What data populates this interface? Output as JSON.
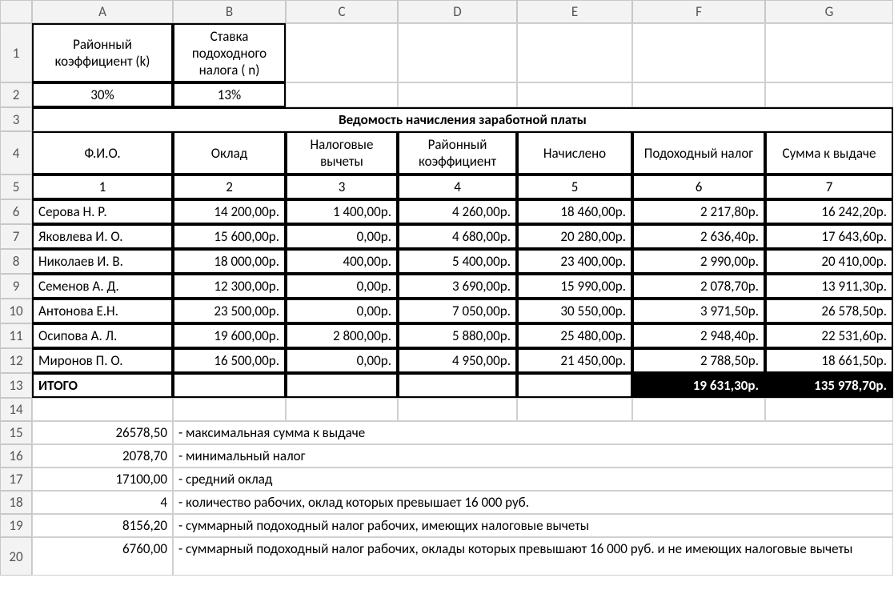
{
  "colLetters": [
    "A",
    "B",
    "C",
    "D",
    "E",
    "F",
    "G"
  ],
  "rowNums": [
    "1",
    "2",
    "3",
    "4",
    "5",
    "6",
    "7",
    "8",
    "9",
    "10",
    "11",
    "12",
    "13",
    "14",
    "15",
    "16",
    "17",
    "18",
    "19",
    "20"
  ],
  "hdr": {
    "A": "Районный коэффициент (k)",
    "B": "Ставка подоходного налога ( n)"
  },
  "vals": {
    "A": "30%",
    "B": "13%"
  },
  "title": "Ведомость начисления заработной платы",
  "th": {
    "A": "Ф.И.О.",
    "B": "Оклад",
    "C": "Налоговые вычеты",
    "D": "Районный коэффициент",
    "E": "Начислено",
    "F": "Подоходный налог",
    "G": "Сумма к выдаче"
  },
  "colnums": {
    "A": "1",
    "B": "2",
    "C": "3",
    "D": "4",
    "E": "5",
    "F": "6",
    "G": "7"
  },
  "rows": [
    {
      "A": "Серова Н. Р.",
      "B": "14 200,00р.",
      "C": "1 400,00р.",
      "D": "4 260,00р.",
      "E": "18 460,00р.",
      "F": "2 217,80р.",
      "G": "16 242,20р."
    },
    {
      "A": "Яковлева И. О.",
      "B": "15 600,00р.",
      "C": "0,00р.",
      "D": "4 680,00р.",
      "E": "20 280,00р.",
      "F": "2 636,40р.",
      "G": "17 643,60р."
    },
    {
      "A": "Николаев И. В.",
      "B": "18 000,00р.",
      "C": "400,00р.",
      "D": "5 400,00р.",
      "E": "23 400,00р.",
      "F": "2 990,00р.",
      "G": "20 410,00р."
    },
    {
      "A": "Семенов А. Д.",
      "B": "12 300,00р.",
      "C": "0,00р.",
      "D": "3 690,00р.",
      "E": "15 990,00р.",
      "F": "2 078,70р.",
      "G": "13 911,30р."
    },
    {
      "A": "Антонова Е.Н.",
      "B": "23 500,00р.",
      "C": "0,00р.",
      "D": "7 050,00р.",
      "E": "30 550,00р.",
      "F": "3 971,50р.",
      "G": "26 578,50р."
    },
    {
      "A": "Осипова А. Л.",
      "B": "19 600,00р.",
      "C": "2 800,00р.",
      "D": "5 880,00р.",
      "E": "25 480,00р.",
      "F": "2 948,40р.",
      "G": "22 531,60р."
    },
    {
      "A": "Миронов П. О.",
      "B": "16 500,00р.",
      "C": "0,00р.",
      "D": "4 950,00р.",
      "E": "21 450,00р.",
      "F": "2 788,50р.",
      "G": "18 661,50р."
    }
  ],
  "total": {
    "label": "ИТОГО",
    "F": "19 631,30р.",
    "G": "135 978,70р."
  },
  "stats": [
    {
      "v": "26578,50",
      "t": " - максимальная сумма к выдаче"
    },
    {
      "v": "2078,70",
      "t": " - минимальный налог"
    },
    {
      "v": "17100,00",
      "t": " - средний оклад"
    },
    {
      "v": "4",
      "t": " - количество рабочих, оклад которых превышает 16 000 руб."
    },
    {
      "v": "8156,20",
      "t": " - суммарный подоходный налог рабочих, имеющих налоговые вычеты"
    },
    {
      "v": "6760,00",
      "t": " - суммарный подоходный налог рабочих, оклады которых превышают 16 000 руб. и не имеющих налоговые вычеты"
    }
  ]
}
